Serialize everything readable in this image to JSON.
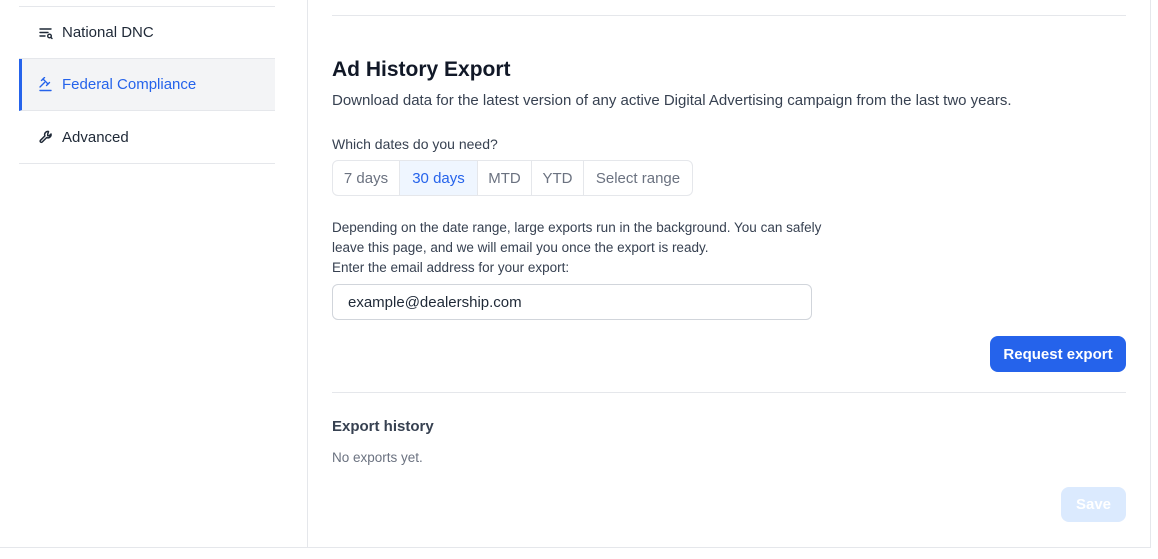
{
  "sidebar": {
    "items": [
      {
        "label": "National DNC",
        "icon": "list-filter-icon",
        "active": false
      },
      {
        "label": "Federal Compliance",
        "icon": "gavel-icon",
        "active": true
      },
      {
        "label": "Advanced",
        "icon": "wrench-icon",
        "active": false
      }
    ]
  },
  "export": {
    "title": "Ad History Export",
    "description": "Download data for the latest version of any active Digital Advertising campaign from the last two years.",
    "dates_question": "Which dates do you need?",
    "ranges": [
      "7 days",
      "30 days",
      "MTD",
      "YTD",
      "Select range"
    ],
    "selected_range": "30 days",
    "note_line1": "Depending on the date range, large exports run in the background. You can safely",
    "note_line2": "leave this page, and we will email you once the export is ready.",
    "email_prompt": "Enter the email address for your export:",
    "email_value": "example@dealership.com",
    "request_label": "Request export"
  },
  "history": {
    "title": "Export history",
    "empty_text": "No exports yet."
  },
  "footer": {
    "save_label": "Save"
  },
  "colors": {
    "accent": "#2563eb",
    "active_bg": "#f3f4f6",
    "border": "#e5e7eb",
    "disabled_button": "#dbeafe"
  }
}
